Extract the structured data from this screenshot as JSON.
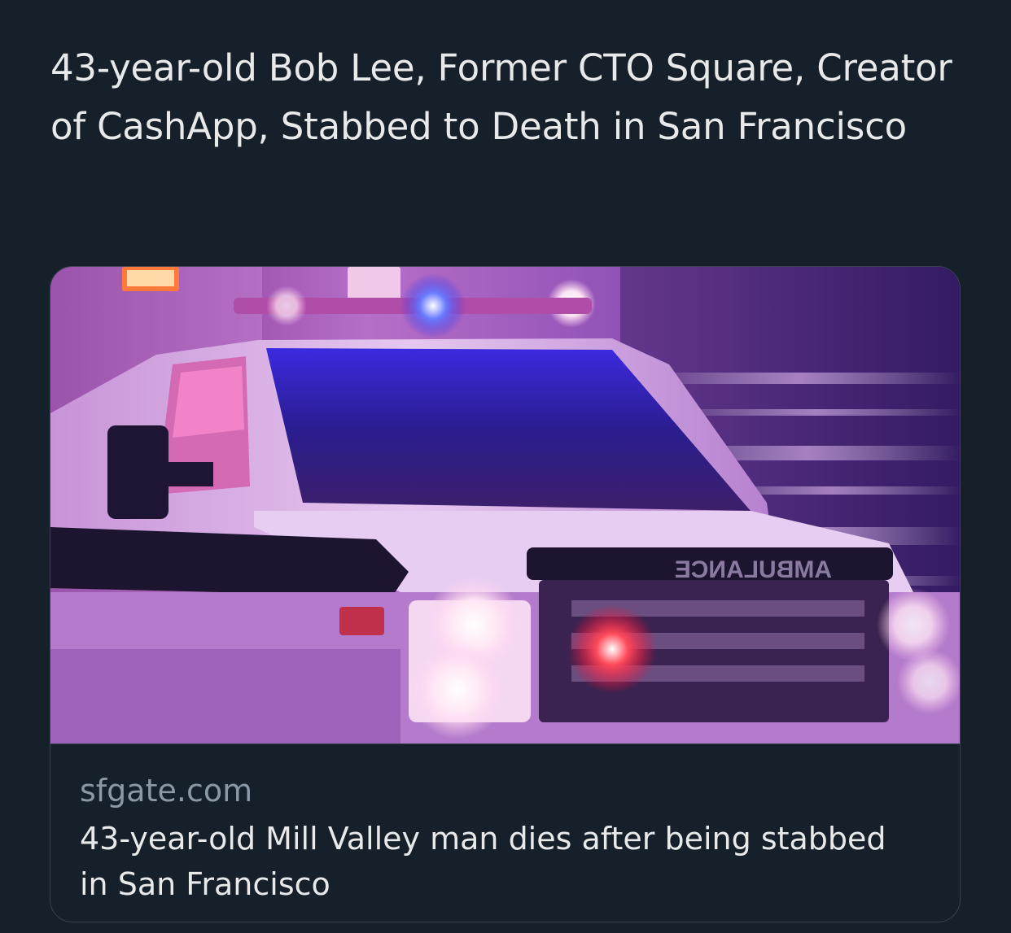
{
  "tweet": {
    "text": "43-year-old Bob Lee, Former CTO Square, Creator of CashApp, Stabbed to Death in San Francisco"
  },
  "card": {
    "domain": "sfgate.com",
    "title": "43-year-old Mill Valley man dies after being stabbed in San Francisco",
    "image": {
      "vehicle_text": "AMBULANCE"
    }
  },
  "colors": {
    "background": "#15202b",
    "text_primary": "#e7e9ea",
    "text_secondary": "#8b98a5",
    "card_border": "#38444d"
  }
}
